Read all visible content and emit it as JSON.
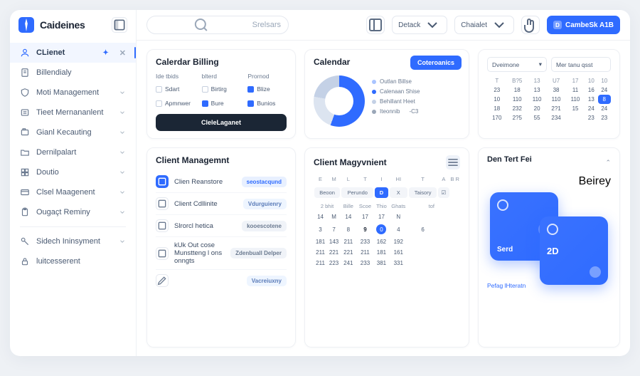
{
  "brand": "Caideines",
  "search_placeholder": "Srelsars",
  "topbar": {
    "detack": "Detack",
    "chaialet": "Chaialet",
    "primary": "CambeSk A1B"
  },
  "sidebar": {
    "items": [
      {
        "label": "CLienet",
        "active": true
      },
      {
        "label": "Billendialy"
      },
      {
        "label": "Moti Management"
      },
      {
        "label": "Tieet Mernananlent"
      },
      {
        "label": "Gianl Kecauting"
      },
      {
        "label": "Dernilpalart"
      },
      {
        "label": "Doutio"
      },
      {
        "label": "Clsel Maagenent"
      },
      {
        "label": "Ougaçt Reminy"
      }
    ],
    "footer": [
      {
        "label": "Sidech Ininsyment"
      },
      {
        "label": "luitcesserent"
      }
    ]
  },
  "billing": {
    "title": "Calerdar Billing",
    "cols": [
      "Ide tbids",
      "blterd",
      "Prornod"
    ],
    "rows": [
      [
        "Sdart",
        "Birtirg",
        "Blize"
      ],
      [
        "Apmnwer",
        "Bure",
        "Bunios"
      ]
    ],
    "cta": "CleleLaganet"
  },
  "donut": {
    "title": "Calendar",
    "btn": "Coteroanics",
    "legend": [
      "Outlan Billse",
      "Calenaan Shise",
      "Behillant Heet",
      "Iteonnib"
    ],
    "legend_val": "-C3"
  },
  "chart_data": {
    "type": "pie",
    "title": "Calendar",
    "series": [
      {
        "name": "Outlan Billse",
        "value": 56,
        "color": "#2f6bff"
      },
      {
        "name": "Calenaan Shise",
        "value": 22,
        "color": "#dce4f0"
      },
      {
        "name": "Behillant Heet",
        "value": 22,
        "color": "#c4d1e6"
      }
    ]
  },
  "minical": {
    "sel1": "Dveimone",
    "sel2": "Mer tanu qsst",
    "head": [
      "T",
      "B?5",
      "13",
      "U7",
      "17",
      "10",
      "10"
    ],
    "rows": [
      [
        "23",
        "18",
        "13",
        "38",
        "11",
        "16",
        "24"
      ],
      [
        "10",
        "110",
        "110",
        "110",
        "110",
        "13",
        "8"
      ],
      [
        "18",
        "232",
        "20",
        "2?1",
        "15",
        "24",
        "24"
      ],
      [
        "170",
        "2?5",
        "55",
        "234",
        "",
        "23",
        "23"
      ]
    ],
    "on": [
      1,
      6
    ]
  },
  "clist": {
    "title": "Client Managemnt",
    "rows": [
      {
        "label": "Clien Reanstore",
        "tag": "seostacqund",
        "tcls": "t1",
        "on": true
      },
      {
        "label": "Client Cdllinite",
        "tag": "Vdurguienry",
        "tcls": "t2"
      },
      {
        "label": "Slrorcl hetica",
        "tag": "kooescotene",
        "tcls": "t3"
      },
      {
        "label": "kUk Out cose Munstteng l ons onngts",
        "tag": "Zdenbuall Delper",
        "tcls": ""
      },
      {
        "label": "",
        "tag": "Vacreiuxny",
        "tcls": "t2",
        "edit": true
      }
    ]
  },
  "cmcal": {
    "title": "Client Magyvnient",
    "head": [
      "E",
      "M",
      "L",
      "T",
      "I",
      "HI",
      "T",
      "A",
      "B",
      "R"
    ],
    "pills": [
      "Beoon",
      "Perundo",
      "D",
      "X",
      "Taisory",
      "☑"
    ],
    "sub": [
      "2 bhit",
      "Bille",
      "Scoe",
      "Thio",
      "Ghats",
      "tof"
    ],
    "rows": [
      [
        "14",
        "M",
        "14",
        "17",
        "17",
        "N"
      ],
      [
        "3",
        "7",
        "8",
        "9",
        "0",
        "4",
        "6"
      ],
      [
        "181",
        "143",
        "211",
        "233",
        "162",
        "192"
      ],
      [
        "211",
        "221",
        "221",
        "211",
        "181",
        "161"
      ],
      [
        "211",
        "223",
        "241",
        "233",
        "381",
        "331"
      ]
    ]
  },
  "tiles": {
    "title": "Den Tert Fei",
    "chip": "Beirey",
    "t1": "Serd",
    "t2": "2D",
    "foot": "Pefag lHteratn"
  }
}
